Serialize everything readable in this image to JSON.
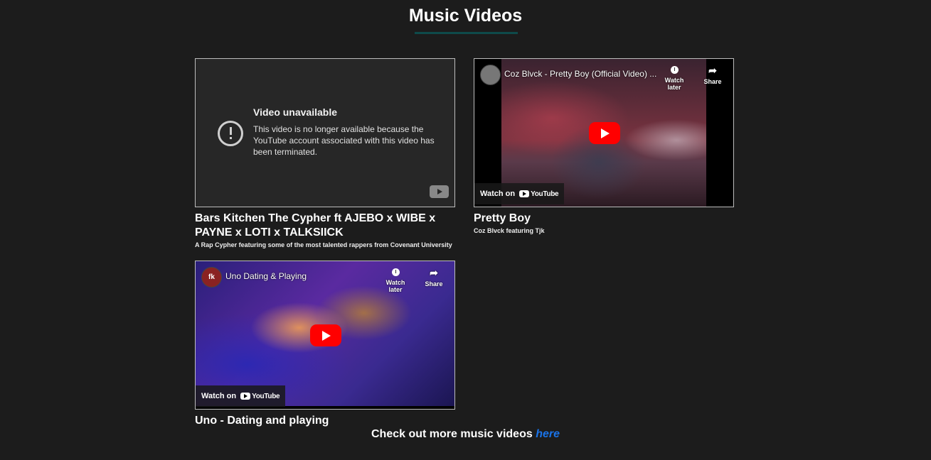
{
  "page": {
    "title": "Music Videos"
  },
  "videos": [
    {
      "status": "unavailable",
      "error_title": "Video unavailable",
      "error_message": "This video is no longer available because the YouTube account associated with this video has been terminated.",
      "title": "Bars Kitchen The Cypher ft AJEBO x WIBE x PAYNE x LOTI x TALKSIICK",
      "description": "A Rap Cypher featuring some of the most talented rappers from Covenant University"
    },
    {
      "status": "available",
      "embed_title": "Coz Blvck - Pretty Boy (Official Video) ...",
      "title": "Pretty Boy",
      "description": "Coz Blvck featuring Tjk"
    },
    {
      "status": "available",
      "channel_initials": "fk",
      "embed_title": "Uno Dating & Playing",
      "title": "Uno - Dating and playing"
    }
  ],
  "player": {
    "watch_later": "Watch later",
    "share": "Share",
    "watch_on": "Watch on",
    "youtube": "YouTube"
  },
  "footer": {
    "text": "Check out more music videos",
    "link": "here",
    "link_color": "#1a73e8"
  }
}
